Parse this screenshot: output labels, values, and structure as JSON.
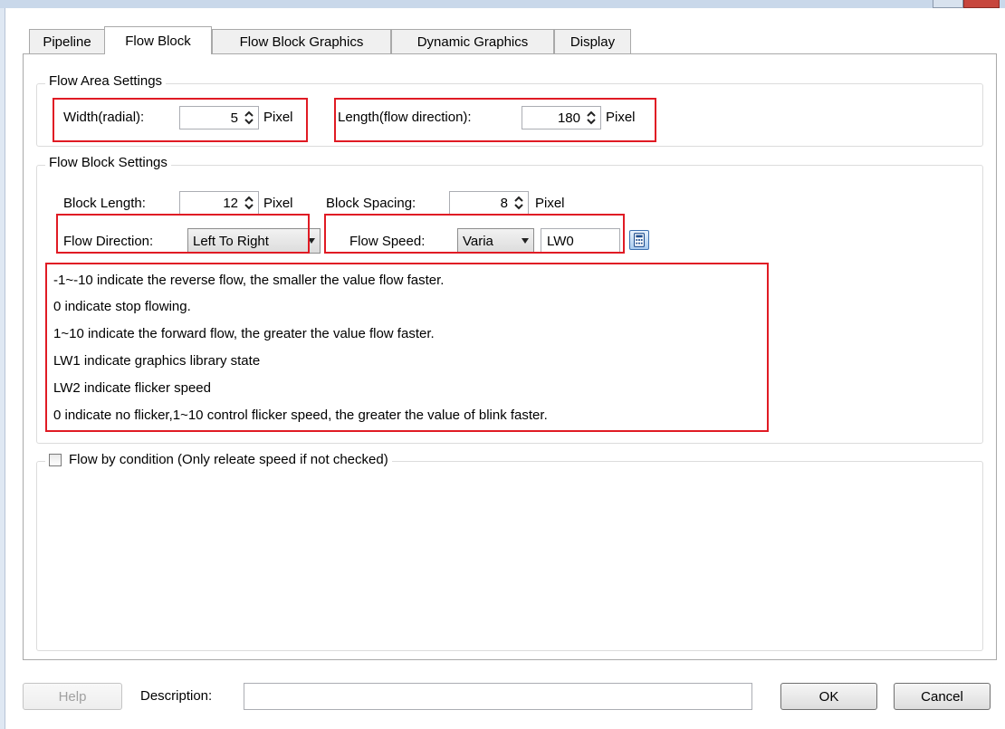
{
  "tabs": [
    "Pipeline",
    "Flow Block",
    "Flow Block Graphics",
    "Dynamic Graphics",
    "Display"
  ],
  "active_tab": "Flow Block",
  "flow_area": {
    "legend": "Flow Area Settings",
    "width_label": "Width(radial):",
    "width_value": "5",
    "width_unit": "Pixel",
    "length_label": "Length(flow direction):",
    "length_value": "180",
    "length_unit": "Pixel"
  },
  "flow_block": {
    "legend": "Flow Block Settings",
    "block_length_label": "Block Length:",
    "block_length_value": "12",
    "block_length_unit": "Pixel",
    "block_spacing_label": "Block Spacing:",
    "block_spacing_value": "8",
    "block_spacing_unit": "Pixel",
    "direction_label": "Flow Direction:",
    "direction_value": "Left To Right",
    "speed_label": "Flow Speed:",
    "speed_mode": "Varia",
    "speed_address": "LW0",
    "info_lines": [
      "-1~-10 indicate the reverse flow, the smaller the value flow faster.",
      "0 indicate stop flowing.",
      "1~10  indicate the forward flow, the greater the value flow faster.",
      "LW1 indicate graphics library state",
      "LW2 indicate flicker speed",
      "0  indicate no flicker,1~10  control  flicker  speed, the greater the value of blink faster."
    ]
  },
  "condition": {
    "label": "Flow by condition (Only releate speed if not checked)",
    "checked": false
  },
  "footer": {
    "help_label": "Help",
    "description_label": "Description:",
    "description_value": "",
    "ok_label": "OK",
    "cancel_label": "Cancel"
  },
  "colors": {
    "highlight": "#e01b24",
    "titlebar": "#c9d8ea"
  },
  "icons": {
    "spin": "up-down-arrows-icon",
    "dropdown": "chevron-down-icon",
    "calculator": "calculator-icon",
    "checkbox": "checkbox-icon"
  }
}
